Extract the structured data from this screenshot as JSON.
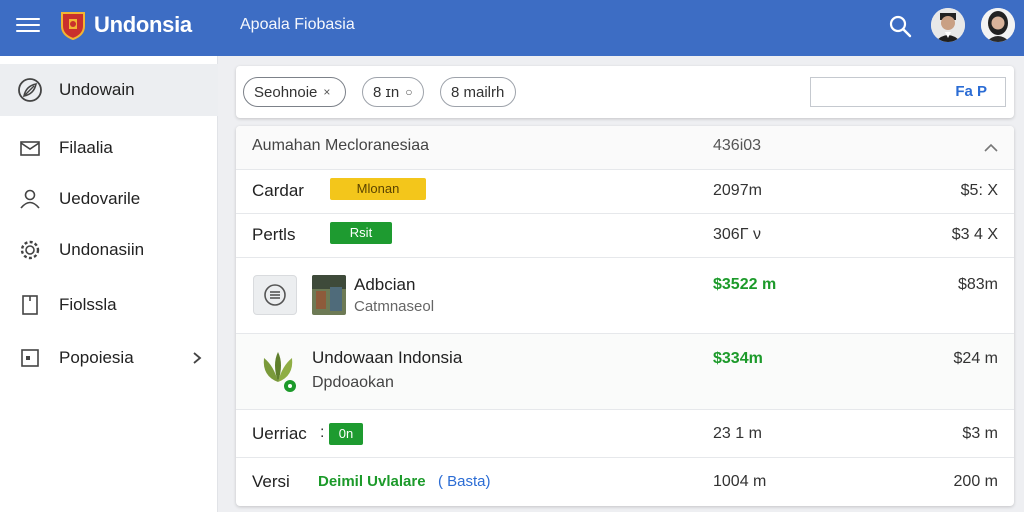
{
  "header": {
    "app_title": "Undonsia",
    "subtitle": "Apoala Fiobasia",
    "icons": {
      "menu": "hamburger-icon",
      "search": "search-icon",
      "logo": "shield-logo"
    }
  },
  "sidebar": {
    "items": [
      {
        "label": "Undowain",
        "icon": "leaf-circle-icon",
        "active": true
      },
      {
        "label": "Filaalia",
        "icon": "envelope-icon"
      },
      {
        "label": "Uedovarile",
        "icon": "person-icon"
      },
      {
        "label": "Undonasiin",
        "icon": "gear-icon"
      },
      {
        "label": "Fiolssla",
        "icon": "document-icon"
      },
      {
        "label": "Popoiesia",
        "icon": "calendar-icon",
        "has_chevron": true
      }
    ]
  },
  "filters": {
    "chips": [
      {
        "label": "Seohnoie",
        "close": "×"
      },
      {
        "label": "8 ɪn",
        "close": "○"
      },
      {
        "label": "8 mailrh"
      }
    ],
    "button_label": "Fa P"
  },
  "table": {
    "header": {
      "name": "Aumahan  Mecloranesiaa",
      "mid": "436i03"
    },
    "rows": [
      {
        "name": "Cardar",
        "badge": "Mlonan",
        "mid": "2097m",
        "right": "$5: X"
      },
      {
        "name": "Pertls",
        "badge": "Rsit",
        "mid": "306Γ ν",
        "right": "$3 4 X"
      },
      {
        "name": "Adbcian",
        "secondary": "Catmnaseol",
        "mid": "$3522 m",
        "right": "$83m"
      },
      {
        "name": "Undowaan Indonsia",
        "secondary": "Dpdoaokan",
        "mid": "$334m",
        "right": "$24 m"
      },
      {
        "name": "Uerriac",
        "badge_prefix": ":",
        "badge": "0n",
        "mid": "23 1 m",
        "right": "$3 m"
      },
      {
        "name": "Versi",
        "green_text": "Deimil  Uvlalare",
        "link_text": "( Basta)",
        "mid": "1004 m",
        "right": "200 m"
      }
    ]
  },
  "colors": {
    "topbar": "#3d6dc4",
    "accent_green": "#1c9a2a",
    "badge_yellow": "#f3c61b",
    "link_blue": "#2b6cd4"
  }
}
